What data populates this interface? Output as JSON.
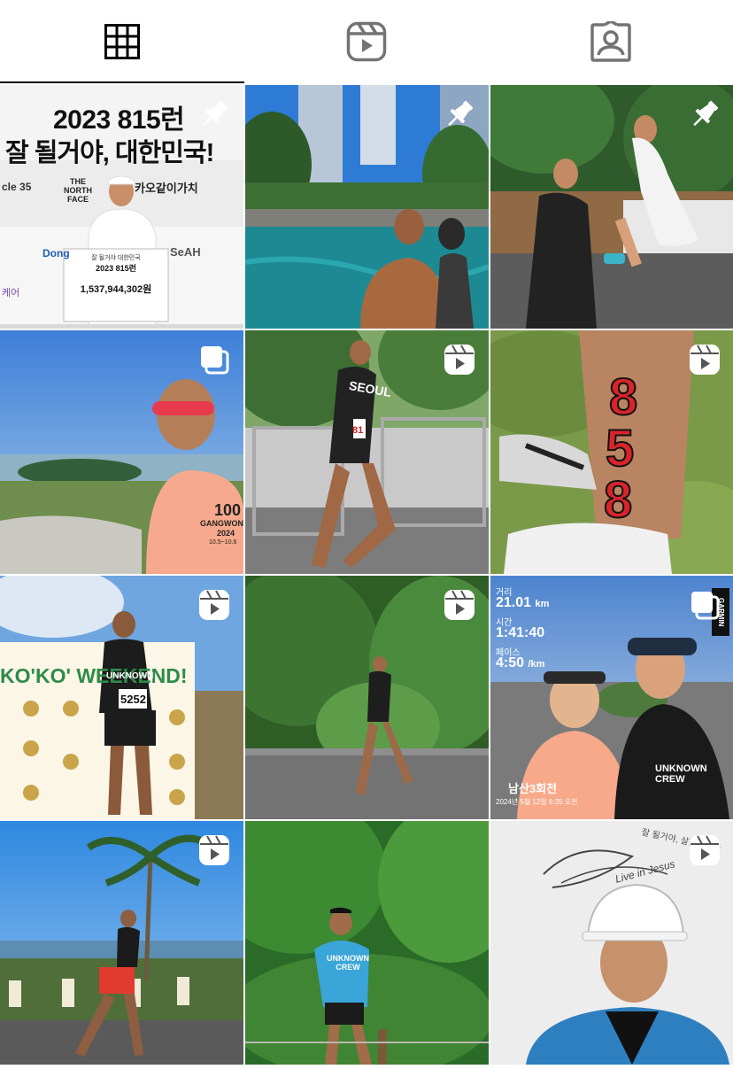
{
  "tabs": [
    {
      "name": "tab-grid",
      "icon": "grid-icon",
      "active": true
    },
    {
      "name": "tab-reels",
      "icon": "reels-icon",
      "active": false
    },
    {
      "name": "tab-tagged",
      "icon": "tagged-person-icon",
      "active": false
    }
  ],
  "posts": {
    "p1": {
      "badge": "pin-icon",
      "headline": "2023 815런",
      "subline": "잘 될거야, 대한민국!",
      "sponsors": [
        "cle 35",
        "THE NORTH FACE",
        "카오같이가치",
        "Dong",
        "SeAH",
        "케어"
      ],
      "board_title_small": "잘 될거야 대한민국",
      "board_title": "2023 815런",
      "board_amount": "1,537,944,302원"
    },
    "p2": {
      "badge": "pin-icon"
    },
    "p3": {
      "badge": "pin-icon"
    },
    "p4": {
      "badge": "carousel-icon",
      "shirt_text": "100",
      "shirt_line1": "GANGWON",
      "shirt_line2": "2024",
      "shirt_line3": "10.5~10.6"
    },
    "p5": {
      "badge": "reels-icon",
      "kit_text": "SEOUL",
      "bib": "81"
    },
    "p6": {
      "badge": "reels-icon",
      "leg_number": [
        "8",
        "5",
        "8"
      ]
    },
    "p7": {
      "badge": "reels-icon",
      "banner": "KO'KO' WEEKEND!",
      "bib": "5252",
      "shirt": "UNKNOWN"
    },
    "p8": {
      "badge": "reels-icon"
    },
    "p9": {
      "badge": "carousel-icon",
      "distance_label": "거리",
      "distance": "21.01",
      "distance_unit": "km",
      "time_label": "시간",
      "time": "1:41:40",
      "pace_label": "페이스",
      "pace": "4:50",
      "pace_unit": "/km",
      "brand": "GARMIN",
      "caption": "남산3회전",
      "caption_date": "2024년 5월 12일 6:25 오전",
      "jacket": "UNKNOWN CREW"
    },
    "p10": {
      "badge": "reels-icon"
    },
    "p11": {
      "shirt": "UNKNOWN CREW"
    },
    "p12": {
      "badge": "reels-icon",
      "signature": "Live in Jesus",
      "wall_note": "잘 될거야, 살겠습니다"
    }
  },
  "colors": {
    "active_tab": "#000000",
    "inactive_tab": "#737373",
    "badge": "#ffffff",
    "leg_number": "#d8242b"
  }
}
